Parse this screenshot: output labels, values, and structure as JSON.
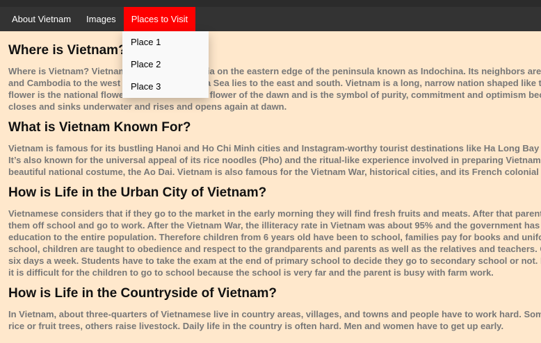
{
  "nav": {
    "items": [
      {
        "label": "About Vietnam"
      },
      {
        "label": "Images"
      },
      {
        "label": "Places to Visit"
      }
    ],
    "active_index": 2,
    "active_color": "#ff0000",
    "background": "#333333"
  },
  "dropdown": {
    "items": [
      {
        "label": "Place 1"
      },
      {
        "label": "Place 2"
      },
      {
        "label": "Place 3"
      }
    ]
  },
  "sections": [
    {
      "heading": "Where is Vietnam?",
      "lines": [
        "Where is Vietnam? Vietnam is in Southeast Asia on the eastern edge of the peninsula known as Indochina. Its neighbors are China, Laos",
        "and Cambodia to the west and the South China Sea lies to the east and south. Vietnam is a long, narrow nation shaped like the letter S. The lotus",
        "flower is the national flower. It is known as the flower of the dawn and is the symbol of purity, commitment and optimism because it",
        "closes and sinks underwater and rises and opens again at dawn."
      ]
    },
    {
      "heading": "What is Vietnam Known For?",
      "lines": [
        "Vietnam is famous for its bustling Hanoi and Ho Chi Minh cities and Instagram-worthy tourist destinations like Ha Long Bay and Hoi An.",
        "It’s also known for the universal appeal of its rice noodles (Pho) and the ritual-like experience involved in preparing Vietnamese coffee, and its",
        "beautiful national costume, the Ao Dai. Vietnam is also famous for the Vietnam War, historical cities, and its French colonial architecture."
      ]
    },
    {
      "heading": "How is Life in the Urban City of Vietnam?",
      "lines": [
        "Vietnamese considers that if they go to the market in the early morning they will find fresh fruits and meats. After that parents take their children",
        "them off school and go to work. After the Vietnam War, the illiteracy rate in Vietnam was about 95% and the government has provided free",
        "education to the entire population. Therefore children from 6 years old have been to school, families pay for books and uniforms. In",
        "school, children are taught to obedience and respect to the grandparents and parents as well as the relatives and teachers. Children go to school",
        "six days a week. Students have to take the exam at the end of primary school to decide they go to secondary school or not. In the countryside,",
        "it is difficult for the children to go to school because the school is very far and the parent is busy with farm work."
      ]
    },
    {
      "heading": "How is Life in the Countryside of Vietnam?",
      "lines": [
        "In Vietnam, about three-quarters of Vietnamese live in country areas, villages, and towns and people have to work hard. Some people grow",
        "rice or fruit trees, others raise livestock. Daily life in the country is often hard. Men and women have to get up early."
      ]
    }
  ]
}
